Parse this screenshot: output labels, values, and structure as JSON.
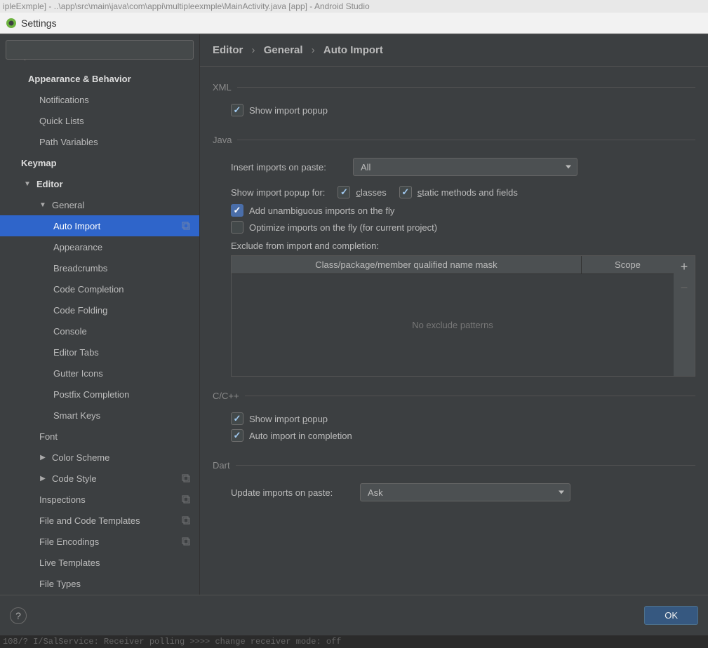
{
  "bg_titlebar": "ipleExmple] - ..\\app\\src\\main\\java\\com\\appi\\multipleexmple\\MainActivity.java [app] - Android Studio",
  "window_title": "Settings",
  "search_placeholder": "",
  "sidebar": {
    "items": [
      {
        "label": "Appearance & Behavior",
        "bold": true,
        "level": "bold",
        "arrow": ""
      },
      {
        "label": "Notifications",
        "level": "level1"
      },
      {
        "label": "Quick Lists",
        "level": "level1"
      },
      {
        "label": "Path Variables",
        "level": "level1"
      },
      {
        "label": "Keymap",
        "bold": true,
        "level": "bold"
      },
      {
        "label": "Editor",
        "level": "level2",
        "arrow": "▼"
      },
      {
        "label": "General",
        "level": "level3",
        "arrow": "▼"
      },
      {
        "label": "Auto Import",
        "level": "level4",
        "selected": true,
        "copy": true
      },
      {
        "label": "Appearance",
        "level": "level4"
      },
      {
        "label": "Breadcrumbs",
        "level": "level4"
      },
      {
        "label": "Code Completion",
        "level": "level4"
      },
      {
        "label": "Code Folding",
        "level": "level4"
      },
      {
        "label": "Console",
        "level": "level4"
      },
      {
        "label": "Editor Tabs",
        "level": "level4"
      },
      {
        "label": "Gutter Icons",
        "level": "level4"
      },
      {
        "label": "Postfix Completion",
        "level": "level4"
      },
      {
        "label": "Smart Keys",
        "level": "level4"
      },
      {
        "label": "Font",
        "level": "level1"
      },
      {
        "label": "Color Scheme",
        "level": "level3",
        "arrow": "▶"
      },
      {
        "label": "Code Style",
        "level": "level3",
        "arrow": "▶",
        "copy": true
      },
      {
        "label": "Inspections",
        "level": "level1",
        "copy": true
      },
      {
        "label": "File and Code Templates",
        "level": "level1",
        "copy": true
      },
      {
        "label": "File Encodings",
        "level": "level1",
        "copy": true
      },
      {
        "label": "Live Templates",
        "level": "level1"
      },
      {
        "label": "File Types",
        "level": "level1"
      }
    ]
  },
  "breadcrumb": [
    "Editor",
    "General",
    "Auto Import"
  ],
  "sections": {
    "xml": {
      "title": "XML",
      "show_import_popup": "Show import popup"
    },
    "java": {
      "title": "Java",
      "insert_label": "Insert imports on paste:",
      "insert_value": "All",
      "show_popup_for": "Show import popup for:",
      "classes": "classes",
      "static_methods": "static methods and fields",
      "add_unambiguous": "Add unambiguous imports on the fly",
      "optimize": "Optimize imports on the fly (for current project)",
      "exclude_label": "Exclude from import and completion:",
      "col_mask": "Class/package/member qualified name mask",
      "col_scope": "Scope",
      "empty_text": "No exclude patterns"
    },
    "cpp": {
      "title": "C/C++",
      "show_import_popup": "Show import popup",
      "auto_import_completion": "Auto import in completion"
    },
    "dart": {
      "title": "Dart",
      "update_label": "Update imports on paste:",
      "update_value": "Ask"
    }
  },
  "footer": {
    "help": "?",
    "ok": "OK"
  },
  "console_bg": "108/? I/SalService: Receiver polling >>>> change receiver mode: off"
}
